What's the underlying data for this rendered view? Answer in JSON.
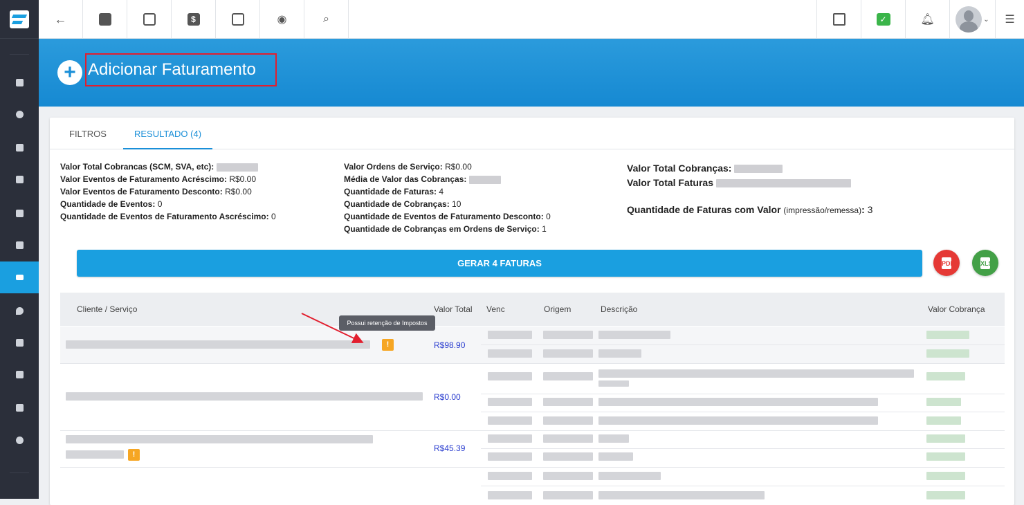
{
  "app": {
    "brand": "logo"
  },
  "sidebar": {
    "items": [
      {
        "name": "dashboard"
      },
      {
        "name": "reports"
      },
      {
        "name": "customers"
      },
      {
        "name": "contracts"
      },
      {
        "name": "scheduling"
      },
      {
        "name": "products"
      },
      {
        "name": "billing",
        "active": true
      },
      {
        "name": "locations"
      },
      {
        "name": "documents"
      },
      {
        "name": "services"
      },
      {
        "name": "files"
      },
      {
        "name": "settings"
      }
    ]
  },
  "topbar": {
    "left_icons": [
      "back-arrow-icon",
      "contact-card-icon",
      "calendar-clock-icon",
      "dollar-icon",
      "terminal-icon",
      "eye-icon",
      "search-icon"
    ],
    "right_icons": [
      "pdf-icon",
      "check-message-icon",
      "bell-icon",
      "avatar",
      "menu-list-icon"
    ]
  },
  "header": {
    "title": "Adicionar Faturamento",
    "plus": "+"
  },
  "tabs": [
    {
      "label": "FILTROS"
    },
    {
      "label": "RESULTADO (4)",
      "active": true
    }
  ],
  "summary_col1": [
    {
      "label": "Valor Total Cobrancas (SCM, SVA, etc):",
      "value": ""
    },
    {
      "label": "Valor Eventos de Faturamento Acréscimo:",
      "value": "R$0.00"
    },
    {
      "label": "Valor Eventos de Faturamento Desconto:",
      "value": "R$0.00"
    },
    {
      "label": "Quantidade de Eventos:",
      "value": "0"
    },
    {
      "label": "Quantidade de Eventos de Faturamento Ascréscimo:",
      "value": "0"
    }
  ],
  "summary_col2": [
    {
      "label": "Valor Ordens de Serviço:",
      "value": "R$0.00"
    },
    {
      "label": "Média de Valor das Cobranças:",
      "value": ""
    },
    {
      "label": "Quantidade de Faturas:",
      "value": "4"
    },
    {
      "label": "Quantidade de Cobranças:",
      "value": "10"
    },
    {
      "label": "Quantidade de Eventos de Faturamento Desconto:",
      "value": "0"
    },
    {
      "label": "Quantidade de Cobranças em Ordens de Serviço:",
      "value": "1"
    }
  ],
  "summary_col3": {
    "total_cobrancas_label": "Valor Total Cobranças:",
    "total_faturas_label": "Valor Total Faturas",
    "qtd_faturas_valor_label": "Quantidade de Faturas com Valor",
    "qtd_faturas_valor_sub": "(impressão/remessa)",
    "qtd_faturas_valor_colon": ":",
    "qtd_faturas_valor": "3"
  },
  "actions": {
    "generate_label": "GERAR 4 FATURAS",
    "pdf_label": "PDF",
    "xls_label": "XLS"
  },
  "table": {
    "headers": {
      "cliente": "Cliente / Serviço",
      "valor_total": "Valor Total",
      "venc": "Venc",
      "origem": "Origem",
      "descricao": "Descrição",
      "valor_cobranca": "Valor Cobrança"
    },
    "rows": [
      {
        "valor_total": "R$98.90",
        "warning": "!"
      },
      {
        "valor_total": "R$0.00"
      },
      {
        "valor_total": "R$45.39",
        "warning": "!"
      }
    ],
    "tooltip": "Possui retenção de Impostos"
  }
}
